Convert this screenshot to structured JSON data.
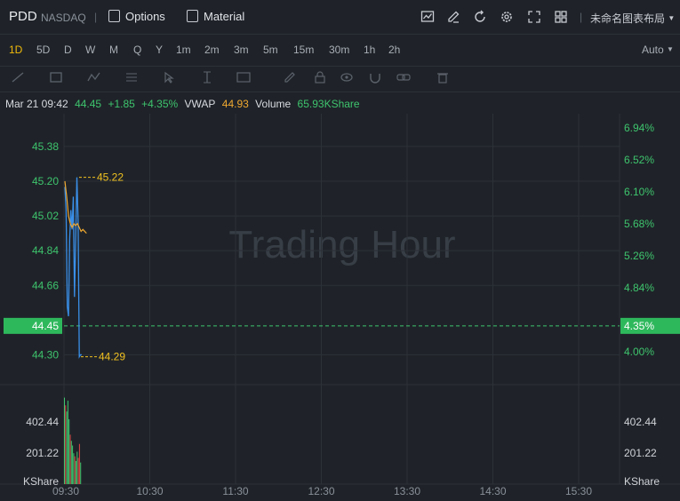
{
  "header": {
    "symbol": "PDD",
    "exchange": "NASDAQ",
    "separator": "|",
    "options_label": "Options",
    "material_label": "Material",
    "layout_label": "未命名图表布局",
    "toolbar_icons": [
      "chart-icon",
      "edit-icon",
      "refresh-icon",
      "settings-icon",
      "fullscreen-icon",
      "grid-icon"
    ]
  },
  "timeframes": [
    "1D",
    "5D",
    "D",
    "W",
    "M",
    "Q",
    "Y",
    "1m",
    "2m",
    "3m",
    "5m",
    "15m",
    "30m",
    "1h",
    "2h"
  ],
  "active_timeframe": "1D",
  "auto_label": "Auto",
  "draw_tools": [
    "line-tool-icon",
    "rect-tool-icon",
    "pattern-tool-icon",
    "fib-tool-icon",
    "cursor-tool-icon",
    "measure-tool-icon",
    "text-tool-icon",
    "pencil-icon",
    "lock-icon",
    "eye-icon",
    "magnet-icon",
    "link-icon",
    "trash-icon"
  ],
  "info": {
    "datetime": "Mar 21 09:42",
    "price": "44.45",
    "change": "+1.85",
    "change_pct": "+4.35%",
    "vwap_label": "VWAP",
    "vwap": "44.93",
    "volume_label": "Volume",
    "volume": "65.93KShare"
  },
  "chart_data": {
    "type": "line",
    "watermark": "Trading Hour",
    "x_ticks": [
      "09:30",
      "10:30",
      "11:30",
      "12:30",
      "13:30",
      "14:30",
      "15:30"
    ],
    "price_ticks": [
      "45.38",
      "45.20",
      "45.02",
      "44.84",
      "44.66",
      "44.30"
    ],
    "pct_ticks": [
      "6.94%",
      "6.52%",
      "6.10%",
      "5.68%",
      "5.26%",
      "4.84%",
      "4.00%"
    ],
    "current_price_label": "44.45",
    "current_pct_label": "4.35%",
    "high_label": "45.22",
    "low_label": "44.29",
    "ylim": [
      44.15,
      45.55
    ],
    "price_series": [
      45.17,
      45.05,
      44.55,
      44.5,
      44.9,
      45.05,
      44.95,
      45.12,
      44.6,
      44.9,
      45.22,
      45.0,
      44.29,
      44.3,
      44.3
    ],
    "vwap_series": [
      45.2,
      45.12,
      45.02,
      44.98,
      44.96,
      44.98,
      44.97,
      44.98,
      44.96,
      44.94,
      44.95,
      44.94,
      44.93
    ],
    "volume_ticks": [
      "402.44",
      "201.22",
      "KShare"
    ],
    "volume_ylim": [
      0,
      603.66
    ],
    "volume_values": [
      560,
      510,
      470,
      540,
      420,
      320,
      280,
      250,
      200,
      180,
      150,
      210,
      170,
      260,
      140
    ],
    "volume_colors": [
      "#3ec46d",
      "#e04545",
      "#3ec46d",
      "#3ec46d",
      "#3ec46d",
      "#e04545",
      "#3ec46d",
      "#3ec46d",
      "#3ec46d",
      "#e04545",
      "#3ec46d",
      "#3ec46d",
      "#e04545",
      "#e04545",
      "#3ec46d"
    ],
    "colors": {
      "price": "#3a8fe8",
      "vwap": "#f0a830",
      "up": "#3ec46d",
      "label_yellow": "#f0c020",
      "grid": "#2c3138"
    }
  }
}
